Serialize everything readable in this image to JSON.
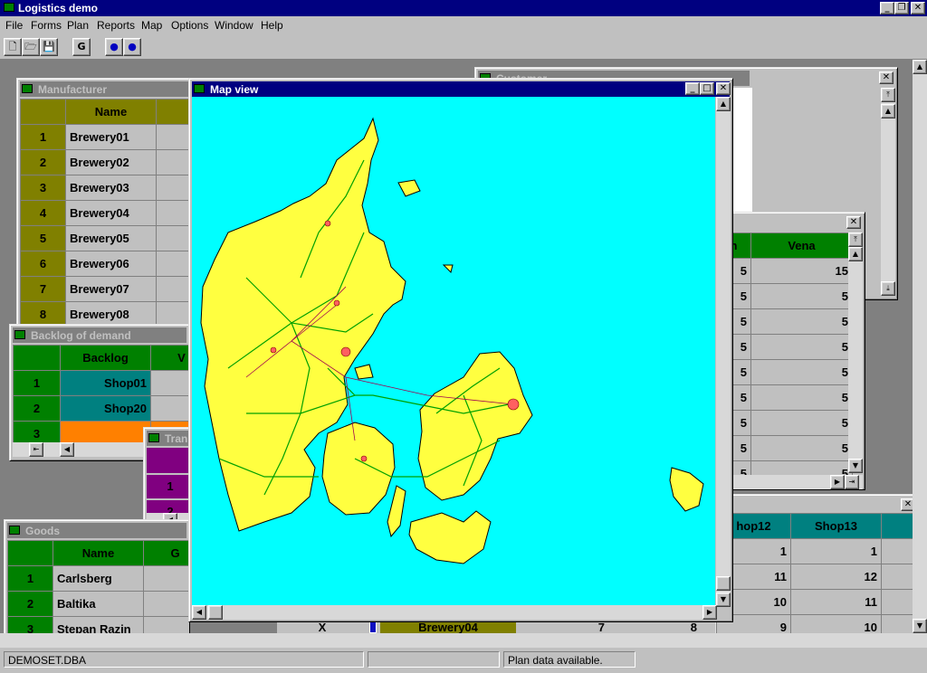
{
  "app": {
    "title": "Logistics demo"
  },
  "menu": [
    "File",
    "Forms",
    "Plan",
    "Reports",
    "Map",
    "Options",
    "Window",
    "Help"
  ],
  "toolbar": {
    "g_label": "G"
  },
  "manufacturer": {
    "title": "Manufacturer",
    "header": "Name",
    "rows": [
      [
        "1",
        "Brewery01"
      ],
      [
        "2",
        "Brewery02"
      ],
      [
        "3",
        "Brewery03"
      ],
      [
        "4",
        "Brewery04"
      ],
      [
        "5",
        "Brewery05"
      ],
      [
        "6",
        "Brewery06"
      ],
      [
        "7",
        "Brewery07"
      ],
      [
        "8",
        "Brewery08"
      ]
    ]
  },
  "backlog": {
    "title": "Backlog of demand",
    "headers": [
      "Backlog",
      "V"
    ],
    "rows": [
      [
        "1",
        "Shop01"
      ],
      [
        "2",
        "Shop20"
      ],
      [
        "3",
        ""
      ]
    ]
  },
  "transport": {
    "title": "Tran",
    "rows": [
      "1",
      "2"
    ]
  },
  "goods": {
    "title": "Goods",
    "headers": [
      "Name",
      "G"
    ],
    "rows": [
      [
        "1",
        "Carlsberg"
      ],
      [
        "2",
        "Baltika"
      ],
      [
        "3",
        "Stepan Razin"
      ]
    ]
  },
  "customer": {
    "title": "Customer"
  },
  "vena": {
    "headers": [
      "n",
      "Vena"
    ],
    "rows": [
      [
        "5",
        "15"
      ],
      [
        "5",
        "5"
      ],
      [
        "5",
        "5"
      ],
      [
        "5",
        "5"
      ],
      [
        "5",
        "5"
      ],
      [
        "5",
        "5"
      ],
      [
        "5",
        "5"
      ],
      [
        "5",
        "5"
      ],
      [
        "5",
        "5"
      ]
    ]
  },
  "shops": {
    "headers": [
      "hop12",
      "Shop13"
    ],
    "rows": [
      [
        "1",
        "1"
      ],
      [
        "11",
        "12"
      ],
      [
        "10",
        "11"
      ],
      [
        "9",
        "10"
      ]
    ]
  },
  "plan_strip": {
    "mark": "X",
    "brewery": "Brewery04",
    "v1": "7",
    "v2": "8"
  },
  "mapview": {
    "title": "Map view"
  },
  "status": {
    "file": "DEMOSET.DBA",
    "middle": "",
    "message": "Plan data available."
  }
}
